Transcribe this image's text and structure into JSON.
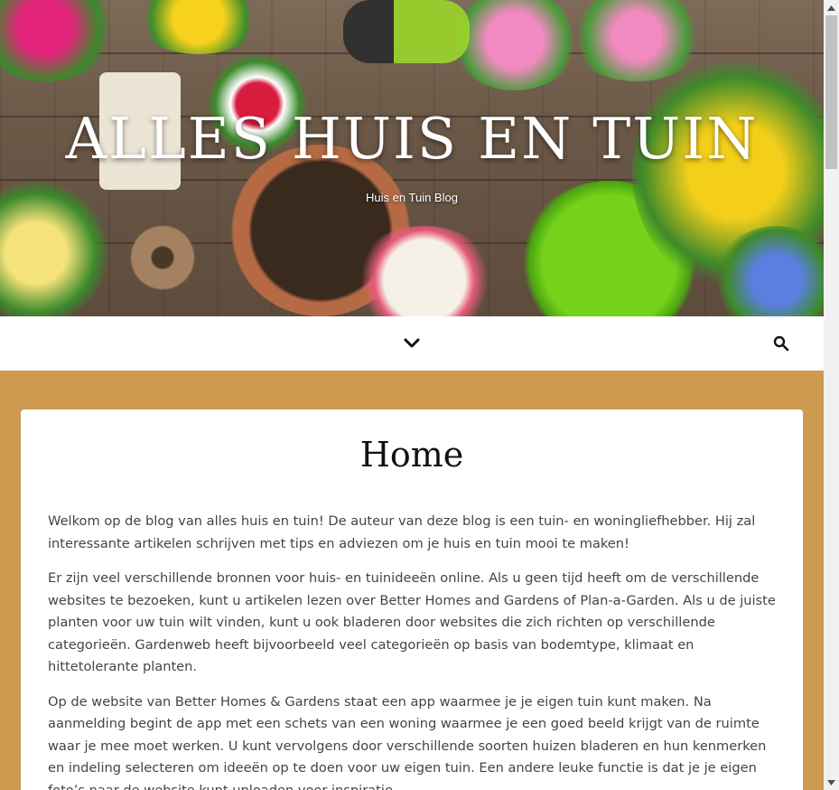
{
  "site": {
    "title": "ALLES HUIS EN TUIN",
    "tagline": "Huis en Tuin Blog"
  },
  "nav": {
    "menu_icon": "chevron-down-icon",
    "search_icon": "search-icon"
  },
  "page": {
    "title": "Home",
    "paragraphs": [
      "Welkom op de blog van alles huis en tuin! De auteur van deze blog is een tuin- en woningliefhebber. Hij zal interessante artikelen schrijven met tips en adviezen om je huis en tuin mooi te maken!",
      "Er zijn veel verschillende bronnen voor huis- en tuinideeën online. Als u geen tijd heeft om de verschillende websites te bezoeken, kunt u artikelen lezen over Better Homes and Gardens of Plan-a-Garden. Als u de juiste planten voor uw tuin wilt vinden, kunt u ook bladeren door websites die zich richten op verschillende categorieën. Gardenweb heeft bijvoorbeeld veel categorieën op basis van bodemtype, klimaat en hittetolerante planten.",
      "Op de website van Better Homes & Gardens staat een app waarmee je je eigen tuin kunt maken. Na aanmelding begint de app met een schets van een woning waarmee je een goed beeld krijgt van de ruimte waar je mee moet werken. U kunt vervolgens door verschillende soorten huizen bladeren en hun kenmerken en indeling selecteren om ideeën op te doen voor uw eigen tuin. Een andere leuke functie is dat je je eigen foto’s naar de website kunt uploaden voor inspiratie."
    ]
  },
  "colors": {
    "background": "#cd9a4f",
    "card": "#ffffff",
    "text": "#444444"
  }
}
